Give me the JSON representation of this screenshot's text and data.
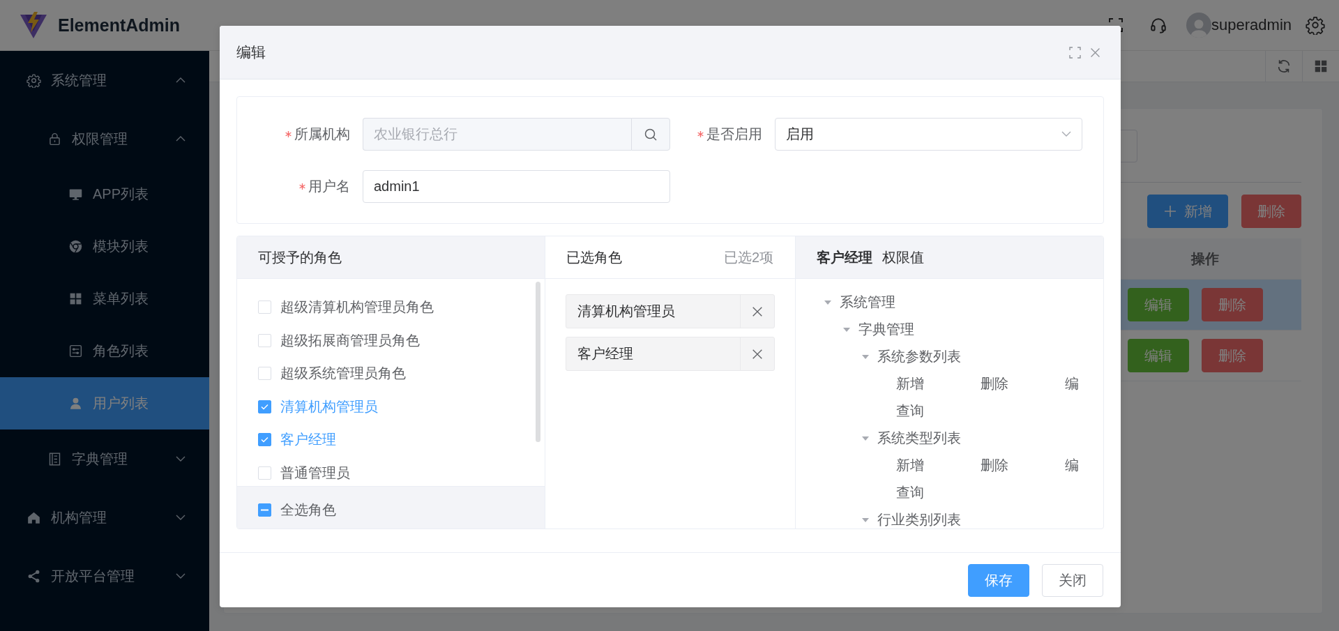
{
  "header": {
    "app_name": "ElementAdmin",
    "username": "superadmin"
  },
  "sidebar": {
    "items": [
      {
        "label": "系统管理",
        "expanded": true,
        "selected": false,
        "children": [
          {
            "label": "权限管理",
            "expanded": true,
            "selected": false,
            "children": [
              {
                "label": "APP列表",
                "selected": false
              },
              {
                "label": "模块列表",
                "selected": false
              },
              {
                "label": "菜单列表",
                "selected": false
              },
              {
                "label": "角色列表",
                "selected": false
              },
              {
                "label": "用户列表",
                "selected": true
              }
            ]
          },
          {
            "label": "字典管理",
            "expanded": false,
            "selected": false
          }
        ]
      },
      {
        "label": "机构管理",
        "expanded": false,
        "selected": false
      },
      {
        "label": "开放平台管理",
        "expanded": false,
        "selected": false
      }
    ]
  },
  "page": {
    "toolbar": [
      {
        "label": "新增",
        "kind": "primary"
      },
      {
        "label": "删除",
        "kind": "danger"
      }
    ],
    "table": {
      "columns": [
        "操作"
      ],
      "rows": [
        {
          "selected": true,
          "actions": [
            {
              "label": "编辑",
              "kind": "success"
            },
            {
              "label": "删除",
              "kind": "danger"
            }
          ]
        },
        {
          "selected": false,
          "actions": [
            {
              "label": "编辑",
              "kind": "success"
            },
            {
              "label": "删除",
              "kind": "danger"
            }
          ]
        }
      ]
    }
  },
  "dialog": {
    "title": "编辑",
    "form": {
      "fields": [
        {
          "label": "所属机构",
          "required": true,
          "kind": "search",
          "value": "农业银行总行",
          "disabled": true
        },
        {
          "label": "是否启用",
          "required": true,
          "kind": "select",
          "value": "启用",
          "disabled": false
        },
        {
          "label": "用户名",
          "required": true,
          "kind": "text",
          "value": "admin1",
          "disabled": false
        }
      ]
    },
    "transfer": {
      "source": {
        "title": "可授予的角色",
        "items": [
          {
            "label": "超级清算机构管理员角色",
            "checked": false
          },
          {
            "label": "超级拓展商管理员角色",
            "checked": false
          },
          {
            "label": "超级系统管理员角色",
            "checked": false
          },
          {
            "label": "清算机构管理员",
            "checked": true
          },
          {
            "label": "客户经理",
            "checked": true
          },
          {
            "label": "普通管理员",
            "checked": false
          }
        ],
        "check_all": {
          "label": "全选角色",
          "checked": false,
          "indeterminate": true
        }
      },
      "target": {
        "title": "已选角色",
        "count": "已选2项",
        "items": [
          "清算机构管理员",
          "客户经理"
        ]
      }
    },
    "permissions": {
      "role": "客户经理",
      "title": "权限值",
      "tree": [
        {
          "label": "系统管理",
          "expanded": true,
          "children": [
            {
              "label": "字典管理",
              "expanded": true,
              "children": [
                {
                  "label": "系统参数列表",
                  "expanded": true,
                  "actions": [
                    "新增",
                    "删除",
                    "编",
                    "查询"
                  ]
                },
                {
                  "label": "系统类型列表",
                  "expanded": true,
                  "actions": [
                    "新增",
                    "删除",
                    "编",
                    "查询"
                  ]
                },
                {
                  "label": "行业类别列表",
                  "expanded": true
                }
              ]
            }
          ]
        }
      ]
    },
    "buttons": [
      {
        "label": "保存",
        "kind": "primary"
      },
      {
        "label": "关闭",
        "kind": "default"
      }
    ]
  }
}
